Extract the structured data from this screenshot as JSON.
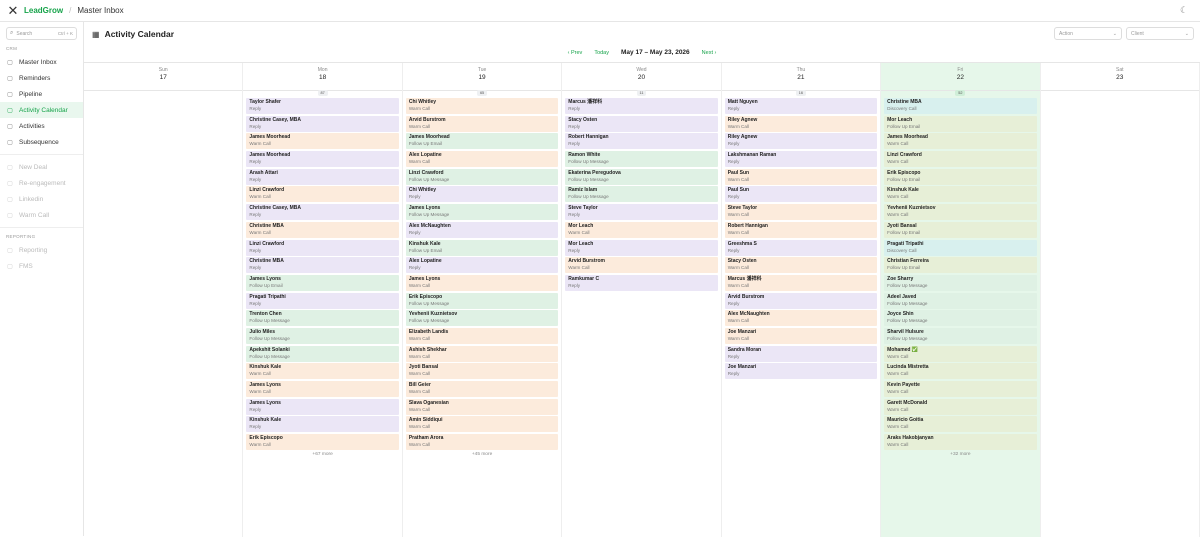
{
  "topbar": {
    "brand": "LeadGrow",
    "separator": "/",
    "breadcrumb": "Master Inbox"
  },
  "sidebar": {
    "search_placeholder": "Search",
    "search_shortcut": "Ctrl + K",
    "crm_label": "CRM",
    "crm_items": [
      {
        "label": "Master Inbox",
        "icon": "inbox-icon"
      },
      {
        "label": "Reminders",
        "icon": "bell-icon"
      },
      {
        "label": "Pipeline",
        "icon": "pipeline-icon"
      },
      {
        "label": "Activity Calendar",
        "icon": "calendar-icon",
        "active": true
      },
      {
        "label": "Activities",
        "icon": "activity-icon"
      },
      {
        "label": "Subsequence",
        "icon": "subsequence-icon"
      }
    ],
    "muted_items": [
      {
        "label": "New Deal",
        "icon": "plus-icon"
      },
      {
        "label": "Re-engagement",
        "icon": "refresh-icon"
      },
      {
        "label": "Linkedin",
        "icon": "linkedin-icon"
      },
      {
        "label": "Warm Call",
        "icon": "phone-icon"
      }
    ],
    "reporting_label": "REPORTING",
    "reporting_items": [
      {
        "label": "Reporting",
        "icon": "report-icon"
      },
      {
        "label": "FMS",
        "icon": "fms-icon"
      }
    ]
  },
  "main": {
    "title": "Activity Calendar",
    "action_placeholder": "Action",
    "client_placeholder": "Client",
    "nav": {
      "prev": "Prev",
      "today": "Today",
      "range": "May 17 – May 23, 2026",
      "next": "Next"
    }
  },
  "days": [
    {
      "dow": "Sun",
      "num": "17",
      "badge": "",
      "more": "",
      "cards": []
    },
    {
      "dow": "Mon",
      "num": "18",
      "badge": "87",
      "more": "+67 more",
      "cards": [
        {
          "name": "Taylor Shafer",
          "type": "Reply",
          "color": "purple"
        },
        {
          "name": "Christine Casey, MBA",
          "type": "Reply",
          "color": "purple"
        },
        {
          "name": "James Moorhead",
          "type": "Warm Call",
          "color": "orange"
        },
        {
          "name": "James Moorhead",
          "type": "Reply",
          "color": "purple"
        },
        {
          "name": "Arash Attari",
          "type": "Reply",
          "color": "purple"
        },
        {
          "name": "Linzi Crawford",
          "type": "Warm Call",
          "color": "orange"
        },
        {
          "name": "Christine Casey, MBA",
          "type": "Reply",
          "color": "purple"
        },
        {
          "name": "Christine MBA",
          "type": "Warm Call",
          "color": "orange"
        },
        {
          "name": "Linzi Crawford",
          "type": "Reply",
          "color": "purple"
        },
        {
          "name": "Christine MBA",
          "type": "Reply",
          "color": "purple"
        },
        {
          "name": "James Lyons",
          "type": "Follow Up Email",
          "color": "green"
        },
        {
          "name": "Pragati Tripathi",
          "type": "Reply",
          "color": "purple"
        },
        {
          "name": "Trenton Chen",
          "type": "Follow Up Message",
          "color": "green"
        },
        {
          "name": "Julio Miles",
          "type": "Follow Up Message",
          "color": "green"
        },
        {
          "name": "Apekshit Solanki",
          "type": "Follow Up Message",
          "color": "green"
        },
        {
          "name": "Kinshuk Kale",
          "type": "Warm Call",
          "color": "orange"
        },
        {
          "name": "James Lyons",
          "type": "Warm Call",
          "color": "orange"
        },
        {
          "name": "James Lyons",
          "type": "Reply",
          "color": "purple"
        },
        {
          "name": "Kinshuk Kale",
          "type": "Reply",
          "color": "purple"
        },
        {
          "name": "Erik Episcopo",
          "type": "Warm Call",
          "color": "orange"
        }
      ]
    },
    {
      "dow": "Tue",
      "num": "19",
      "badge": "65",
      "more": "+45 more",
      "cards": [
        {
          "name": "Chi Whitley",
          "type": "Warm Call",
          "color": "orange"
        },
        {
          "name": "Arvid Burstrom",
          "type": "Warm Call",
          "color": "orange"
        },
        {
          "name": "James Moorhead",
          "type": "Follow Up Email",
          "color": "green"
        },
        {
          "name": "Alex Lopatine",
          "type": "Warm Call",
          "color": "orange"
        },
        {
          "name": "Linzi Crawford",
          "type": "Follow Up Message",
          "color": "green"
        },
        {
          "name": "Chi Whitley",
          "type": "Reply",
          "color": "purple"
        },
        {
          "name": "James Lyons",
          "type": "Follow Up Message",
          "color": "green"
        },
        {
          "name": "Alex McNaughten",
          "type": "Reply",
          "color": "purple"
        },
        {
          "name": "Kinshuk Kale",
          "type": "Follow Up Email",
          "color": "green"
        },
        {
          "name": "Alex Lopatine",
          "type": "Reply",
          "color": "purple"
        },
        {
          "name": "James Lyons",
          "type": "Warm Call",
          "color": "orange"
        },
        {
          "name": "Erik Episcopo",
          "type": "Follow Up Message",
          "color": "green"
        },
        {
          "name": "Yevhenii Kuznietsov",
          "type": "Follow Up Message",
          "color": "green"
        },
        {
          "name": "Elizabeth Landis",
          "type": "Warm Call",
          "color": "orange"
        },
        {
          "name": "Ashish Shekhar",
          "type": "Warm Call",
          "color": "orange"
        },
        {
          "name": "Jyoti Bansal",
          "type": "Warm Call",
          "color": "orange"
        },
        {
          "name": "Bill Geier",
          "type": "Warm Call",
          "color": "orange"
        },
        {
          "name": "Slava Oganesian",
          "type": "Warm Call",
          "color": "orange"
        },
        {
          "name": "Amin Siddiqui",
          "type": "Warm Call",
          "color": "orange"
        },
        {
          "name": "Pratham Arora",
          "type": "Warm Call",
          "color": "orange"
        }
      ]
    },
    {
      "dow": "Wed",
      "num": "20",
      "badge": "11",
      "more": "",
      "cards": [
        {
          "name": "Marcus 潘祥科",
          "type": "Reply",
          "color": "purple"
        },
        {
          "name": "Stacy Osten",
          "type": "Reply",
          "color": "purple"
        },
        {
          "name": "Robert Hannigan",
          "type": "Reply",
          "color": "purple"
        },
        {
          "name": "Ramon White",
          "type": "Follow Up Message",
          "color": "green"
        },
        {
          "name": "Ekaterina Peregudova",
          "type": "Follow Up Message",
          "color": "green"
        },
        {
          "name": "Ramiz Islam",
          "type": "Follow Up Message",
          "color": "green"
        },
        {
          "name": "Steve Taylor",
          "type": "Reply",
          "color": "purple"
        },
        {
          "name": "Mor Leach",
          "type": "Warm Call",
          "color": "orange"
        },
        {
          "name": "Mor Leach",
          "type": "Reply",
          "color": "purple"
        },
        {
          "name": "Arvid Burstrom",
          "type": "Warm Call",
          "color": "orange"
        },
        {
          "name": "Ramkumar C",
          "type": "Reply",
          "color": "purple"
        }
      ]
    },
    {
      "dow": "Thu",
      "num": "21",
      "badge": "16",
      "more": "",
      "cards": [
        {
          "name": "Matt Nguyen",
          "type": "Reply",
          "color": "purple"
        },
        {
          "name": "Riley Agnew",
          "type": "Warm Call",
          "color": "orange"
        },
        {
          "name": "Riley Agnew",
          "type": "Reply",
          "color": "purple"
        },
        {
          "name": "Lakshmanan Raman",
          "type": "Reply",
          "color": "purple"
        },
        {
          "name": "Paul Sun",
          "type": "Warm Call",
          "color": "orange"
        },
        {
          "name": "Paul Sun",
          "type": "Reply",
          "color": "purple"
        },
        {
          "name": "Steve Taylor",
          "type": "Warm Call",
          "color": "orange"
        },
        {
          "name": "Robert Hannigan",
          "type": "Warm Call",
          "color": "orange"
        },
        {
          "name": "Greeshma S",
          "type": "Reply",
          "color": "purple"
        },
        {
          "name": "Stacy Osten",
          "type": "Warm Call",
          "color": "orange"
        },
        {
          "name": "Marcus 潘祥科",
          "type": "Warm Call",
          "color": "orange"
        },
        {
          "name": "Arvid Burstrom",
          "type": "Reply",
          "color": "purple"
        },
        {
          "name": "Alex McNaughten",
          "type": "Warm Call",
          "color": "orange"
        },
        {
          "name": "Joe Manzari",
          "type": "Warm Call",
          "color": "orange"
        },
        {
          "name": "Sandra Moran",
          "type": "Reply",
          "color": "purple"
        },
        {
          "name": "Joe Manzari",
          "type": "Reply",
          "color": "purple"
        }
      ]
    },
    {
      "dow": "Fri",
      "num": "22",
      "badge": "52",
      "more": "+32 more",
      "highlight": true,
      "cards": [
        {
          "name": "Christine MBA",
          "type": "Discovery Call",
          "color": "teal"
        },
        {
          "name": "Mor Leach",
          "type": "Follow Up Email",
          "color": "olive"
        },
        {
          "name": "James Moorhead",
          "type": "Warm Call",
          "color": "olive"
        },
        {
          "name": "Linzi Crawford",
          "type": "Warm Call",
          "color": "olive"
        },
        {
          "name": "Erik Episcopo",
          "type": "Follow Up Email",
          "color": "olive"
        },
        {
          "name": "Kinshuk Kale",
          "type": "Warm Call",
          "color": "olive"
        },
        {
          "name": "Yevhenii Kuznietsov",
          "type": "Warm Call",
          "color": "olive"
        },
        {
          "name": "Jyoti Bansal",
          "type": "Follow Up Email",
          "color": "olive"
        },
        {
          "name": "Pragati Tripathi",
          "type": "Discovery Call",
          "color": "teal"
        },
        {
          "name": "Christian Ferreira",
          "type": "Follow Up Email",
          "color": "olive"
        },
        {
          "name": "Zoe Sharry",
          "type": "Follow Up Message",
          "color": "green"
        },
        {
          "name": "Adeel Javed",
          "type": "Follow Up Message",
          "color": "green"
        },
        {
          "name": "Joyce Shin",
          "type": "Follow Up Message",
          "color": "green"
        },
        {
          "name": "Sharvil Hulsure",
          "type": "Follow Up Message",
          "color": "green"
        },
        {
          "name": "Mohamed ✅",
          "type": "Warm Call",
          "color": "olive"
        },
        {
          "name": "Lucinda Mistretta",
          "type": "Warm Call",
          "color": "olive"
        },
        {
          "name": "Kevin Payette",
          "type": "Warm Call",
          "color": "olive"
        },
        {
          "name": "Garett McDonald",
          "type": "Warm Call",
          "color": "olive"
        },
        {
          "name": "Mauricio Goitia",
          "type": "Warm Call",
          "color": "olive"
        },
        {
          "name": "Araks Hakobjanyan",
          "type": "Warm Call",
          "color": "olive"
        }
      ]
    },
    {
      "dow": "Sat",
      "num": "23",
      "badge": "",
      "more": "",
      "cards": []
    }
  ],
  "colors": {
    "accent": "#16a34a",
    "highlight_bg": "#e6f7ea"
  }
}
